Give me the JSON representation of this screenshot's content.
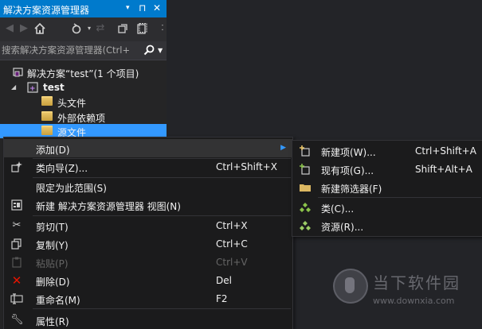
{
  "panel": {
    "title": "解决方案资源管理器",
    "title_icons": [
      "▾",
      "⊓",
      "✕"
    ],
    "search_placeholder": "搜索解决方案资源管理器(Ctrl+",
    "solution_label": "解决方案“test”(1 个项目)",
    "project_label": "test",
    "folders": [
      "头文件",
      "外部依赖项",
      "源文件"
    ]
  },
  "context_menu": {
    "items": [
      {
        "label": "添加(D)",
        "shortcut": ""
      },
      {
        "label": "类向导(Z)...",
        "shortcut": "Ctrl+Shift+X"
      },
      {
        "label": "限定为此范围(S)",
        "shortcut": ""
      },
      {
        "label": "新建 解决方案资源管理器 视图(N)",
        "shortcut": ""
      },
      {
        "label": "剪切(T)",
        "shortcut": "Ctrl+X"
      },
      {
        "label": "复制(Y)",
        "shortcut": "Ctrl+C"
      },
      {
        "label": "粘贴(P)",
        "shortcut": "Ctrl+V"
      },
      {
        "label": "删除(D)",
        "shortcut": "Del"
      },
      {
        "label": "重命名(M)",
        "shortcut": "F2"
      },
      {
        "label": "属性(R)",
        "shortcut": ""
      }
    ]
  },
  "submenu": {
    "items": [
      {
        "label": "新建项(W)...",
        "shortcut": "Ctrl+Shift+A"
      },
      {
        "label": "现有项(G)...",
        "shortcut": "Shift+Alt+A"
      },
      {
        "label": "新建筛选器(F)",
        "shortcut": ""
      },
      {
        "label": "类(C)...",
        "shortcut": ""
      },
      {
        "label": "资源(R)...",
        "shortcut": ""
      }
    ]
  },
  "watermark": {
    "brand": "当下软件园",
    "url": "www.downxia.com"
  }
}
